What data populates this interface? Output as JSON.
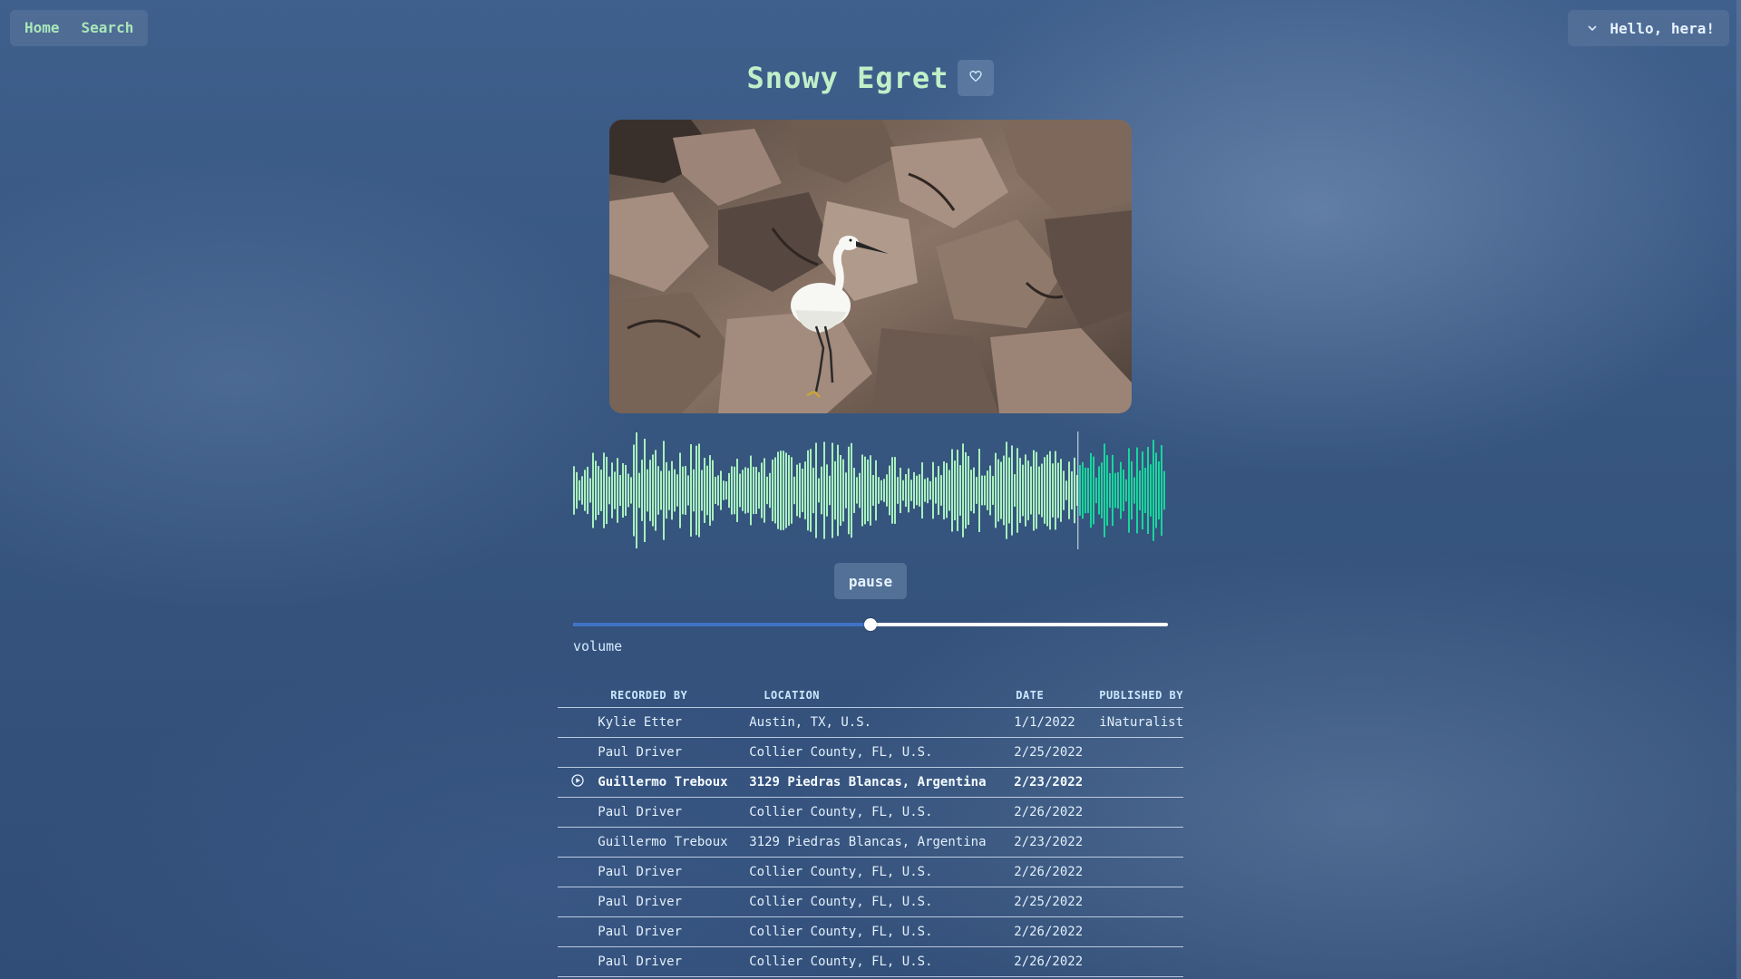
{
  "nav": {
    "links": [
      {
        "label": "Home"
      },
      {
        "label": "Search"
      }
    ]
  },
  "user_menu": {
    "icon": "chevron-down-icon",
    "greeting": "Hello, hera!"
  },
  "species": {
    "name": "Snowy Egret",
    "favorite_icon": "heart-icon"
  },
  "player": {
    "played_fraction": 0.848,
    "pause_label": "pause",
    "volume_label": "volume",
    "volume_level": 0.5,
    "colors": {
      "played": "#a8f0bd",
      "unplayed": "#19d59c",
      "cursor": "#dfe9f3",
      "accent": "#3f73c6"
    }
  },
  "recordings": {
    "columns": [
      "RECORDED BY",
      "LOCATION",
      "DATE",
      "PUBLISHED BY"
    ],
    "rows": [
      {
        "recorded_by": "Kylie Etter",
        "location": "Austin, TX, U.S.",
        "date": "1/1/2022",
        "published_by": "iNaturalist",
        "playing": false
      },
      {
        "recorded_by": "Paul Driver",
        "location": "Collier County, FL, U.S.",
        "date": "2/25/2022",
        "published_by": "",
        "playing": false
      },
      {
        "recorded_by": "Guillermo Treboux",
        "location": "3129 Piedras Blancas, Argentina",
        "date": "2/23/2022",
        "published_by": "",
        "playing": true
      },
      {
        "recorded_by": "Paul Driver",
        "location": "Collier County, FL, U.S.",
        "date": "2/26/2022",
        "published_by": "",
        "playing": false
      },
      {
        "recorded_by": "Guillermo Treboux",
        "location": "3129 Piedras Blancas, Argentina",
        "date": "2/23/2022",
        "published_by": "",
        "playing": false
      },
      {
        "recorded_by": "Paul Driver",
        "location": "Collier County, FL, U.S.",
        "date": "2/26/2022",
        "published_by": "",
        "playing": false
      },
      {
        "recorded_by": "Paul Driver",
        "location": "Collier County, FL, U.S.",
        "date": "2/25/2022",
        "published_by": "",
        "playing": false
      },
      {
        "recorded_by": "Paul Driver",
        "location": "Collier County, FL, U.S.",
        "date": "2/26/2022",
        "published_by": "",
        "playing": false
      },
      {
        "recorded_by": "Paul Driver",
        "location": "Collier County, FL, U.S.",
        "date": "2/26/2022",
        "published_by": "",
        "playing": false
      }
    ],
    "playing_icon": "play-circle-icon"
  }
}
